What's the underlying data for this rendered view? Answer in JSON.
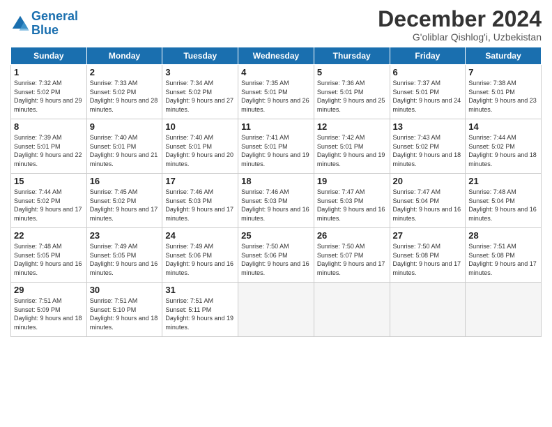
{
  "header": {
    "logo_line1": "General",
    "logo_line2": "Blue",
    "month": "December 2024",
    "location": "G'oliblar Qishlog'i, Uzbekistan"
  },
  "weekdays": [
    "Sunday",
    "Monday",
    "Tuesday",
    "Wednesday",
    "Thursday",
    "Friday",
    "Saturday"
  ],
  "weeks": [
    [
      {
        "day": "1",
        "rise": "7:32 AM",
        "set": "5:02 PM",
        "daylight": "9 hours and 29 minutes."
      },
      {
        "day": "2",
        "rise": "7:33 AM",
        "set": "5:02 PM",
        "daylight": "9 hours and 28 minutes."
      },
      {
        "day": "3",
        "rise": "7:34 AM",
        "set": "5:02 PM",
        "daylight": "9 hours and 27 minutes."
      },
      {
        "day": "4",
        "rise": "7:35 AM",
        "set": "5:01 PM",
        "daylight": "9 hours and 26 minutes."
      },
      {
        "day": "5",
        "rise": "7:36 AM",
        "set": "5:01 PM",
        "daylight": "9 hours and 25 minutes."
      },
      {
        "day": "6",
        "rise": "7:37 AM",
        "set": "5:01 PM",
        "daylight": "9 hours and 24 minutes."
      },
      {
        "day": "7",
        "rise": "7:38 AM",
        "set": "5:01 PM",
        "daylight": "9 hours and 23 minutes."
      }
    ],
    [
      {
        "day": "8",
        "rise": "7:39 AM",
        "set": "5:01 PM",
        "daylight": "9 hours and 22 minutes."
      },
      {
        "day": "9",
        "rise": "7:40 AM",
        "set": "5:01 PM",
        "daylight": "9 hours and 21 minutes."
      },
      {
        "day": "10",
        "rise": "7:40 AM",
        "set": "5:01 PM",
        "daylight": "9 hours and 20 minutes."
      },
      {
        "day": "11",
        "rise": "7:41 AM",
        "set": "5:01 PM",
        "daylight": "9 hours and 19 minutes."
      },
      {
        "day": "12",
        "rise": "7:42 AM",
        "set": "5:01 PM",
        "daylight": "9 hours and 19 minutes."
      },
      {
        "day": "13",
        "rise": "7:43 AM",
        "set": "5:02 PM",
        "daylight": "9 hours and 18 minutes."
      },
      {
        "day": "14",
        "rise": "7:44 AM",
        "set": "5:02 PM",
        "daylight": "9 hours and 18 minutes."
      }
    ],
    [
      {
        "day": "15",
        "rise": "7:44 AM",
        "set": "5:02 PM",
        "daylight": "9 hours and 17 minutes."
      },
      {
        "day": "16",
        "rise": "7:45 AM",
        "set": "5:02 PM",
        "daylight": "9 hours and 17 minutes."
      },
      {
        "day": "17",
        "rise": "7:46 AM",
        "set": "5:03 PM",
        "daylight": "9 hours and 17 minutes."
      },
      {
        "day": "18",
        "rise": "7:46 AM",
        "set": "5:03 PM",
        "daylight": "9 hours and 16 minutes."
      },
      {
        "day": "19",
        "rise": "7:47 AM",
        "set": "5:03 PM",
        "daylight": "9 hours and 16 minutes."
      },
      {
        "day": "20",
        "rise": "7:47 AM",
        "set": "5:04 PM",
        "daylight": "9 hours and 16 minutes."
      },
      {
        "day": "21",
        "rise": "7:48 AM",
        "set": "5:04 PM",
        "daylight": "9 hours and 16 minutes."
      }
    ],
    [
      {
        "day": "22",
        "rise": "7:48 AM",
        "set": "5:05 PM",
        "daylight": "9 hours and 16 minutes."
      },
      {
        "day": "23",
        "rise": "7:49 AM",
        "set": "5:05 PM",
        "daylight": "9 hours and 16 minutes."
      },
      {
        "day": "24",
        "rise": "7:49 AM",
        "set": "5:06 PM",
        "daylight": "9 hours and 16 minutes."
      },
      {
        "day": "25",
        "rise": "7:50 AM",
        "set": "5:06 PM",
        "daylight": "9 hours and 16 minutes."
      },
      {
        "day": "26",
        "rise": "7:50 AM",
        "set": "5:07 PM",
        "daylight": "9 hours and 17 minutes."
      },
      {
        "day": "27",
        "rise": "7:50 AM",
        "set": "5:08 PM",
        "daylight": "9 hours and 17 minutes."
      },
      {
        "day": "28",
        "rise": "7:51 AM",
        "set": "5:08 PM",
        "daylight": "9 hours and 17 minutes."
      }
    ],
    [
      {
        "day": "29",
        "rise": "7:51 AM",
        "set": "5:09 PM",
        "daylight": "9 hours and 18 minutes."
      },
      {
        "day": "30",
        "rise": "7:51 AM",
        "set": "5:10 PM",
        "daylight": "9 hours and 18 minutes."
      },
      {
        "day": "31",
        "rise": "7:51 AM",
        "set": "5:11 PM",
        "daylight": "9 hours and 19 minutes."
      },
      null,
      null,
      null,
      null
    ]
  ]
}
